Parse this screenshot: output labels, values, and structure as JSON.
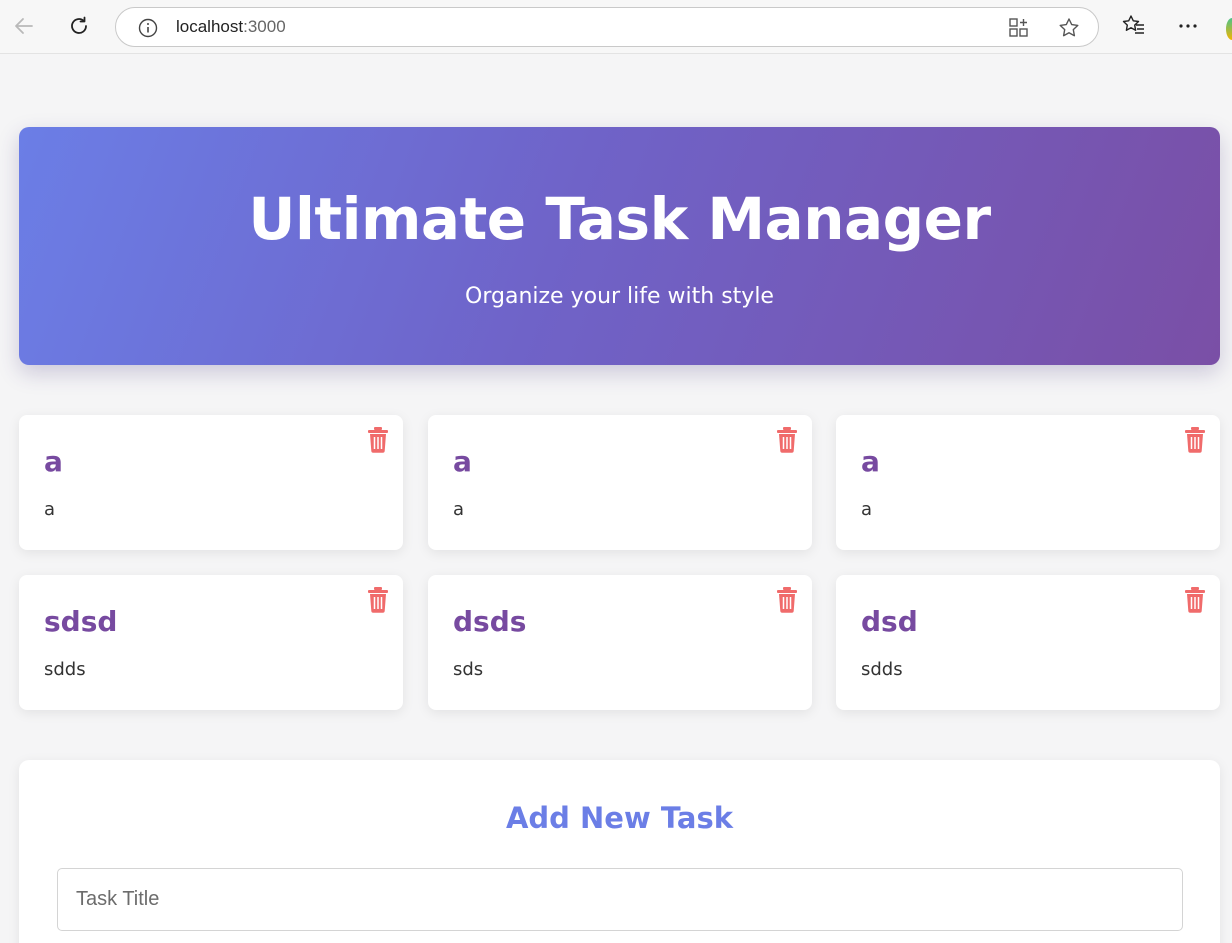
{
  "browser": {
    "url_host": "localhost",
    "url_port": ":3000"
  },
  "hero": {
    "title": "Ultimate Task Manager",
    "subtitle": "Organize your life with style"
  },
  "tasks": [
    {
      "title": "a",
      "description": "a"
    },
    {
      "title": "a",
      "description": "a"
    },
    {
      "title": "a",
      "description": "a"
    },
    {
      "title": "sdsd",
      "description": "sdds"
    },
    {
      "title": "dsds",
      "description": "sds"
    },
    {
      "title": "dsd",
      "description": "sdds"
    }
  ],
  "form": {
    "heading": "Add New Task",
    "title_placeholder": "Task Title"
  },
  "colors": {
    "accent_blue": "#6b7ee6",
    "accent_purple": "#774aa0",
    "delete_red": "#f06b6b"
  },
  "icons": {
    "back": "arrow-left-icon",
    "reload": "reload-icon",
    "info": "info-icon",
    "apps": "apps-icon",
    "favorite": "star-icon",
    "favorites_list": "favorites-icon",
    "more": "more-icon",
    "delete": "trash-icon"
  }
}
